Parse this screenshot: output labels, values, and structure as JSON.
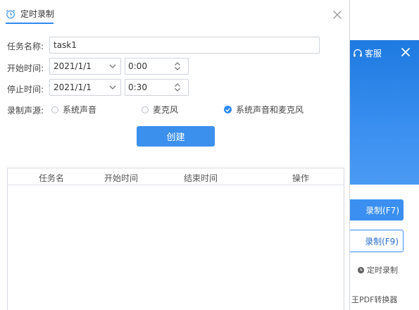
{
  "dialog": {
    "title": "定时录制",
    "fields": {
      "task_name_label": "任务名称:",
      "task_name_value": "task1",
      "start_label": "开始时间:",
      "start_date": "2021/1/1",
      "start_time": "0:00",
      "stop_label": "停止时间:",
      "stop_date": "2021/1/1",
      "stop_time": "0:30",
      "source_label": "录制声源:"
    },
    "sources": [
      {
        "label": "系统声音",
        "checked": false
      },
      {
        "label": "麦克风",
        "checked": false
      },
      {
        "label": "系统声音和麦克风",
        "checked": true
      }
    ],
    "create_button": "创建",
    "table": {
      "columns": [
        "任务名",
        "开始时间",
        "结束时间",
        "操作"
      ],
      "rows": []
    }
  },
  "background": {
    "service_label": "客服",
    "record_button": "录制(F7)",
    "record2_button": "录制(F9)",
    "schedule_label": "定时录制",
    "footer_text": "王PDF转换器"
  },
  "colors": {
    "accent": "#2f8bef",
    "button": "#3b90ee",
    "header_gradient_top": "#1e7ae0"
  },
  "icons": [
    "clock-icon",
    "close-icon",
    "chevron-down-icon",
    "up-down-icon",
    "headset-icon"
  ]
}
